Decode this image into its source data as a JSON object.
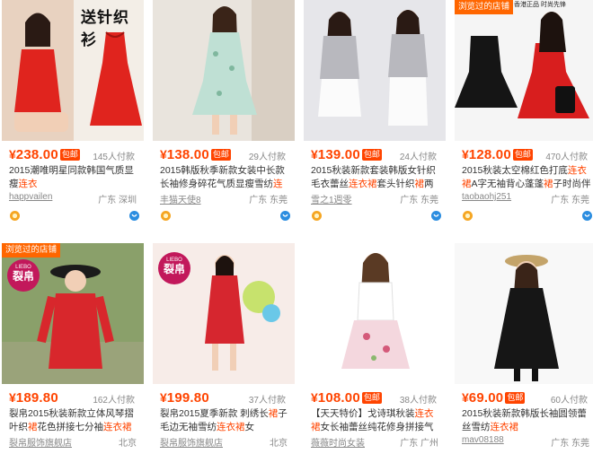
{
  "products": [
    {
      "promo_text": "送针织衫",
      "badge": "",
      "brand_tag": "",
      "liebo": null,
      "price": "238.00",
      "baoyou": "包邮",
      "payers": "145人付款",
      "title_parts": [
        "2015潮唯明星同款韩国气质显瘦",
        "连衣",
        "\n",
        "裙",
        "夏修身中",
        "裙",
        "无袖蓬蓬",
        "裙",
        "礼服秋"
      ],
      "shop": "happvailen",
      "location": "广东 深圳",
      "colors": {
        "dress": "#e0241e",
        "bg": "#f3eee7"
      }
    },
    {
      "promo_text": "",
      "badge": "",
      "brand_tag": "",
      "liebo": null,
      "price": "138.00",
      "baoyou": "包邮",
      "payers": "29人付款",
      "title_parts": [
        "2015韩版秋季新款女装中长款长袖修身碎花气质显瘦雪纺",
        "连衣裙",
        "女裙"
      ],
      "shop": "丰猫天使8",
      "location": "广东 东莞",
      "colors": {
        "dress": "#bfe0d4",
        "bg": "#e9e4dd"
      }
    },
    {
      "promo_text": "",
      "badge": "",
      "brand_tag": "",
      "liebo": null,
      "price": "139.00",
      "baoyou": "包邮",
      "payers": "24人付款",
      "title_parts": [
        "2015秋装新款套装韩版女针织毛衣蕾丝",
        "连衣裙",
        "套头针织",
        "裙",
        "两件套女潮"
      ],
      "shop": "雪之1週零",
      "location": "广东 东莞",
      "colors": {
        "dress": "#b8b8be",
        "bg": "#e6e6ea"
      }
    },
    {
      "promo_text": "",
      "badge": "浏览过的店铺",
      "brand_tag": "香港正品 时尚先锋",
      "liebo": null,
      "price": "128.00",
      "baoyou": "包邮",
      "payers": "470人付款",
      "title_parts": [
        "2015秋装太空棉红色打底",
        "连衣裙",
        "A字无袖背心蓬蓬",
        "裙",
        "子时尚伴娘礼服"
      ],
      "shop": "taobaohj251",
      "location": "广东 东莞",
      "colors": {
        "dress": "#d81e1e",
        "bg": "#f5f5f5"
      }
    },
    {
      "promo_text": "",
      "badge": "浏览过的店铺",
      "brand_tag": "",
      "liebo": {
        "t1": "LIEBO",
        "t2": "裂帛"
      },
      "price": "189.80",
      "baoyou": "",
      "payers": "162人付款",
      "title_parts": [
        "裂帛2015秋装新款立体风琴摺叶织",
        "裙",
        "花色拼接七分袖",
        "连衣裙",
        "女51140711"
      ],
      "shop": "裂帛服饰旗舰店",
      "location": "北京",
      "colors": {
        "dress": "#d8272c",
        "bg": "#8aa06a"
      }
    },
    {
      "promo_text": "",
      "badge": "",
      "brand_tag": "",
      "liebo": {
        "t1": "LIEBO",
        "t2": "裂帛"
      },
      "price": "199.80",
      "baoyou": "",
      "payers": "37人付款",
      "title_parts": [
        "裂帛2015夏季新款 刺绣长",
        "裙",
        "子毛边无袖雪纺",
        "连衣裙",
        "女51140702"
      ],
      "shop": "裂帛服饰旗舰店",
      "location": "北京",
      "colors": {
        "dress": "#d6262f",
        "bg": "#f7ece8"
      }
    },
    {
      "promo_text": "",
      "badge": "",
      "brand_tag": "",
      "liebo": null,
      "price": "108.00",
      "baoyou": "包邮",
      "payers": "38人付款",
      "title_parts": [
        "【天天特价】戈诗琪秋装",
        "连衣裙",
        "女长袖蕾丝纯花修身拼接气质淑女连"
      ],
      "shop": "薇薇时尚女装",
      "location": "广东 广州",
      "colors": {
        "dress": "#f4d7de",
        "bg": "#ffffff"
      }
    },
    {
      "promo_text": "",
      "badge": "",
      "brand_tag": "",
      "liebo": null,
      "price": "69.00",
      "baoyou": "包邮",
      "payers": "60人付款",
      "title_parts": [
        "2015秋装新款韩版长袖圆领蕾丝雪纺",
        "连衣裙",
        "\n",
        "女 大码宽松a字打底",
        "裙",
        "短",
        "裙"
      ],
      "shop": "mav08188",
      "location": "广东 东莞",
      "colors": {
        "dress": "#161616",
        "bg": "#f8f8f8"
      }
    }
  ],
  "ui": {
    "yen_symbol": "¥"
  }
}
